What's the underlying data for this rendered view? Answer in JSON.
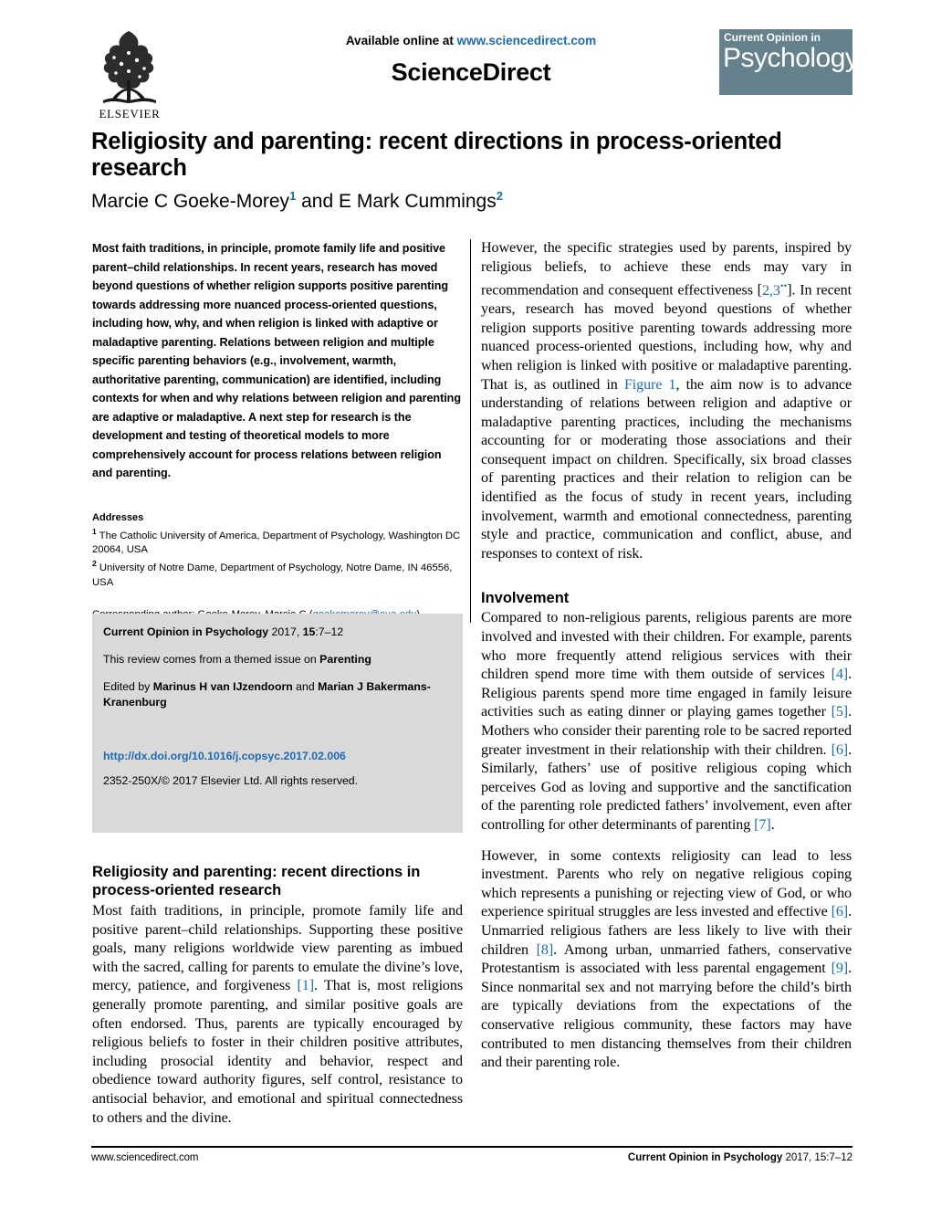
{
  "header": {
    "available_text": "Available online at ",
    "sciencedirect_url": "www.sciencedirect.com",
    "brand": "ScienceDirect",
    "elsevier_label": "ELSEVIER",
    "badge_top": "Current Opinion in",
    "badge_main": "Psychology",
    "badge_color": "#65818b"
  },
  "article": {
    "title": "Religiosity and parenting: recent directions in process-oriented research",
    "authors_part1": "Marcie C Goeke-Morey",
    "authors_sup1": "1",
    "authors_joiner": " and ",
    "authors_part2": "E Mark Cummings",
    "authors_sup2": "2"
  },
  "abstract": {
    "text": "Most faith traditions, in principle, promote family life and positive parent–child relationships. In recent years, research has moved beyond questions of whether religion supports positive parenting towards addressing more nuanced process-oriented questions, including how, why, and when religion is linked with adaptive or maladaptive parenting. Relations between religion and multiple specific parenting behaviors (e.g., involvement, warmth, authoritative parenting, communication) are identified, including contexts for when and why relations between religion and parenting are adaptive or maladaptive. A next step for research is the development and testing of theoretical models to more comprehensively account for process relations between religion and parenting."
  },
  "addresses": {
    "heading": "Addresses",
    "aff1_sup": "1",
    "aff1": " The Catholic University of America, Department of Psychology, Washington DC 20064, USA",
    "aff2_sup": "2",
    "aff2": " University of Notre Dame, Department of Psychology, Notre Dame, IN 46556, USA",
    "corresponding_prefix": "Corresponding author: Goeke-Morey, Marcie C (",
    "corresponding_email": "goekemorey@cua.edu",
    "corresponding_suffix": ")"
  },
  "infobox": {
    "citation_bold": "Current Opinion in Psychology",
    "citation_rest_a": " 2017, ",
    "citation_volume": "15",
    "citation_rest_b": ":7–12",
    "themed_prefix": "This review comes from a themed issue on ",
    "themed_topic": "Parenting",
    "edited_prefix": "Edited by ",
    "editor1": "Marinus H van IJzendoorn",
    "edited_joiner": " and ",
    "editor2": "Marian J Bakermans-Kranenburg",
    "doi": "http://dx.doi.org/10.1016/j.copsyc.2017.02.006",
    "copyright": "2352-250X/© 2017 Elsevier Ltd. All rights reserved."
  },
  "left_lower": {
    "section_title": "Religiosity and parenting: recent directions in process-oriented research",
    "paragraph_a": "Most faith traditions, in principle, promote family life and positive parent–child relationships. Supporting these positive goals, many religions worldwide view parenting as imbued with the sacred, calling for parents to emulate the divine’s love, mercy, patience, and forgiveness ",
    "ref_1": "[1]",
    "paragraph_b": ". That is, most religions generally promote parenting, and similar positive goals are often endorsed. Thus, parents are typically encouraged by religious beliefs to foster in their children positive attributes, including prosocial identity and behavior, respect and obedience toward authority figures, self control, resistance to antisocial behavior, and emotional and spiritual connectedness to others and the divine."
  },
  "right_col": {
    "paragraph1_a": "However, the specific strategies used by parents, inspired by religious beliefs, to achieve these ends may vary in recommendation and consequent effectiveness [",
    "ref_23": "2,3",
    "ref_23_sup": "••",
    "paragraph1_b": "]. In recent years, research has moved beyond questions of whether religion supports positive parenting towards addressing more nuanced process-oriented questions, including how, why and when religion is linked with positive or maladaptive parenting. That is, as outlined in ",
    "figure_link": "Figure 1",
    "paragraph1_c": ", the aim now is to advance understanding of relations between religion and adaptive or maladaptive parenting practices, including the mechanisms accounting for or moderating those associations and their consequent impact on children. Specifically, six broad classes of parenting practices and their relation to religion can be identified as the focus of study in recent years, including involvement, warmth and emotional connectedness, parenting style and practice, communication and conflict, abuse, and responses to context of risk.",
    "section_involvement": "Involvement",
    "inv_a": "Compared to non-religious parents, religious parents are more involved and invested with their children. For example, parents who more frequently attend religious services with their children spend more time with them outside of services ",
    "ref_4": "[4]",
    "inv_b": ". Religious parents spend more time engaged in family leisure activities such as eating dinner or playing games together ",
    "ref_5": "[5]",
    "inv_c": ". Mothers who consider their parenting role to be sacred reported greater investment in their relationship with their children. ",
    "ref_6": "[6]",
    "inv_d": ". Similarly, fathers’ use of positive religious coping which perceives God as loving and supportive and the sanctification of the parenting role predicted fathers’ involvement, even after controlling for other determinants of parenting ",
    "ref_7": "[7]",
    "inv_e": ".",
    "less_a": "However, in some contexts religiosity can lead to less investment. Parents who rely on negative religious coping which represents a punishing or rejecting view of God, or who experience spiritual struggles are less invested and effective ",
    "ref_6b": "[6]",
    "less_b": ". Unmarried religious fathers are less likely to live with their children ",
    "ref_8": "[8]",
    "less_c": ". Among urban, unmarried fathers, conservative Protestantism is associated with less parental engagement ",
    "ref_9": "[9]",
    "less_d": ". Since nonmarital sex and not marrying before the child’s birth are typically deviations from the expectations of the conservative religious community, these factors may have contributed to men distancing themselves from their children and their parenting role."
  },
  "footer": {
    "left": "www.sciencedirect.com",
    "right_bold": "Current Opinion in Psychology",
    "right_rest": " 2017, 15:7–12"
  },
  "colors": {
    "link": "#1b6bb3",
    "infobox_bg": "#d9d9d9",
    "badge_bg": "#65818b"
  }
}
